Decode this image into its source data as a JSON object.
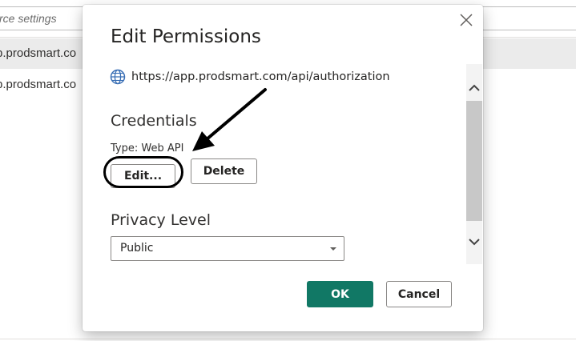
{
  "background": {
    "search_placeholder": "rce settings",
    "rows": [
      {
        "label": "p.prodsmart.co",
        "selected": true
      },
      {
        "label": "p.prodsmart.co",
        "selected": false
      }
    ]
  },
  "dialog": {
    "title": "Edit Permissions",
    "close_icon": "close-icon",
    "url_icon": "globe-icon",
    "url": "https://app.prodsmart.com/api/authorization",
    "credentials": {
      "heading": "Credentials",
      "type_line": "Type: Web API",
      "edit_label": "Edit...",
      "delete_label": "Delete"
    },
    "privacy": {
      "heading": "Privacy Level",
      "selected": "Public"
    },
    "ok_label": "OK",
    "cancel_label": "Cancel"
  },
  "colors": {
    "accent": "#117865",
    "annotation": "#000000"
  }
}
